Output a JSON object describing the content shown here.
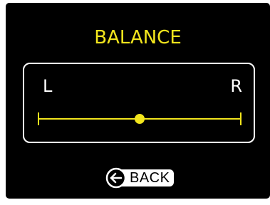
{
  "screen": {
    "title": "BALANCE",
    "accent_color": "#f2e51d"
  },
  "balance": {
    "left_label": "L",
    "right_label": "R",
    "value": 0.5,
    "slider_color": "#f2e51d"
  },
  "back": {
    "label": "BACK",
    "icon": "arrow-left-circle-icon"
  }
}
